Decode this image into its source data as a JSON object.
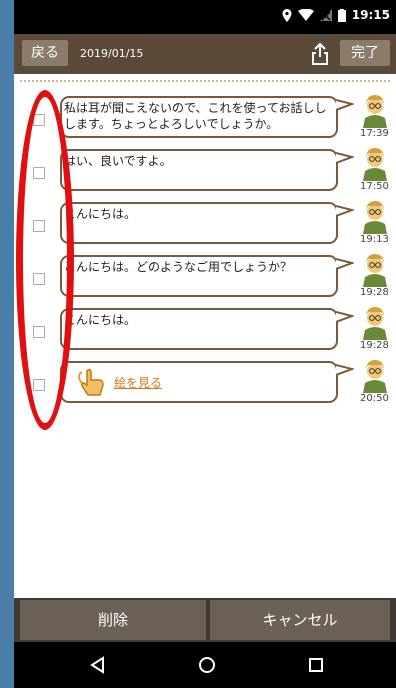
{
  "status": {
    "time": "19:15"
  },
  "header": {
    "back_label": "戻る",
    "date": "2019/01/15",
    "done_label": "完了"
  },
  "messages": [
    {
      "text": "私は耳が聞こえないので、これを使ってお話ししします。ちょっとよろしいでしょうか。",
      "time": "17:39"
    },
    {
      "text": "はい、良いですよ。",
      "time": "17:50"
    },
    {
      "text": "こんにちは。",
      "time": "19:13"
    },
    {
      "text": "こんにちは。どのようなご用でしょうか？",
      "time": "19:28"
    },
    {
      "text": "こんにちは。",
      "time": "19:28"
    },
    {
      "text": "絵を見る",
      "time": "20:50"
    }
  ],
  "footer": {
    "delete_label": "削除",
    "cancel_label": "キャンセル"
  },
  "colors": {
    "header_bg": "#5b4a3a",
    "bubble_border": "#7a5a3c",
    "link": "#d9781a",
    "highlight": "#e01010"
  }
}
